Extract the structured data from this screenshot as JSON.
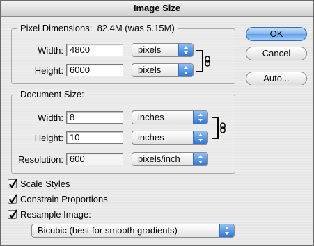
{
  "window": {
    "title": "Image Size"
  },
  "pixel_dimensions": {
    "title": "Pixel Dimensions:",
    "size_info": "82.4M (was 5.15M)",
    "width_label": "Width:",
    "width_value": "4800",
    "width_unit": "pixels",
    "height_label": "Height:",
    "height_value": "6000",
    "height_unit": "pixels"
  },
  "document_size": {
    "title": "Document Size:",
    "width_label": "Width:",
    "width_value": "8",
    "width_unit": "inches",
    "height_label": "Height:",
    "height_value": "10",
    "height_unit": "inches",
    "resolution_label": "Resolution:",
    "resolution_value": "600",
    "resolution_unit": "pixels/inch"
  },
  "buttons": {
    "ok": "OK",
    "cancel": "Cancel",
    "auto": "Auto..."
  },
  "options": {
    "scale_styles": {
      "label": "Scale Styles",
      "checked": true
    },
    "constrain_proportions": {
      "label": "Constrain Proportions",
      "checked": true
    },
    "resample_image": {
      "label": "Resample Image:",
      "checked": true
    },
    "resample_method": "Bicubic (best for smooth gradients)"
  },
  "icons": [
    "chain-link-icon",
    "checkmark-icon",
    "select-arrows-icon"
  ],
  "colors": {
    "default_button": "#5f9fe8",
    "select_arrows": "#2f76d6"
  }
}
